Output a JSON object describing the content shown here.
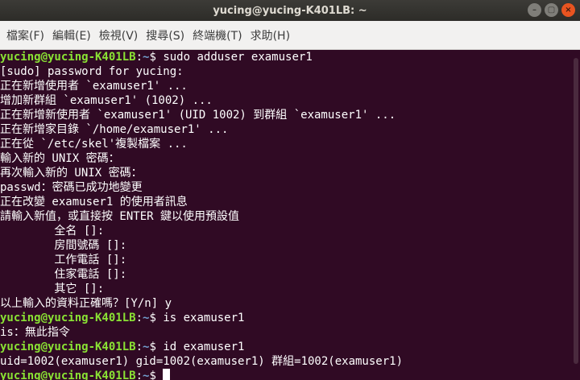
{
  "window": {
    "title": "yucing@yucing-K401LB: ~",
    "min_icon": "–",
    "max_icon": "▢",
    "close_icon": "×"
  },
  "menu": [
    {
      "label": "檔案(F)"
    },
    {
      "label": "編輯(E)"
    },
    {
      "label": "檢視(V)"
    },
    {
      "label": "搜尋(S)"
    },
    {
      "label": "終端機(T)"
    },
    {
      "label": "求助(H)"
    }
  ],
  "prompt": {
    "user_host": "yucing@yucing-K401LB",
    "sep": ":",
    "path": "~",
    "symbol": "$ "
  },
  "lines": [
    {
      "kind": "cmd",
      "text": "sudo adduser examuser1"
    },
    {
      "kind": "out",
      "text": "[sudo] password for yucing:"
    },
    {
      "kind": "out",
      "text": "正在新增使用者 `examuser1' ..."
    },
    {
      "kind": "out",
      "text": "增加新群組 `examuser1' (1002) ..."
    },
    {
      "kind": "out",
      "text": "正在新增新使用者 `examuser1' (UID 1002) 到群組 `examuser1' ..."
    },
    {
      "kind": "out",
      "text": "正在新增家目錄 `/home/examuser1' ..."
    },
    {
      "kind": "out",
      "text": "正在從 `/etc/skel'複製檔案 ..."
    },
    {
      "kind": "out",
      "text": "輸入新的 UNIX 密碼："
    },
    {
      "kind": "out",
      "text": "再次輸入新的 UNIX 密碼："
    },
    {
      "kind": "out",
      "text": "passwd：密碼已成功地變更"
    },
    {
      "kind": "out",
      "text": "正在改變 examuser1 的使用者訊息"
    },
    {
      "kind": "out",
      "text": "請輸入新值，或直接按 ENTER 鍵以使用預設值"
    },
    {
      "kind": "out",
      "text": "        全名 []:"
    },
    {
      "kind": "out",
      "text": "        房間號碼 []:"
    },
    {
      "kind": "out",
      "text": "        工作電話 []:"
    },
    {
      "kind": "out",
      "text": "        住家電話 []:"
    },
    {
      "kind": "out",
      "text": "        其它 []:"
    },
    {
      "kind": "out",
      "text": "以上輸入的資料正確嗎？[Y/n] y"
    },
    {
      "kind": "cmd",
      "text": "is examuser1"
    },
    {
      "kind": "out",
      "text": "is：無此指令"
    },
    {
      "kind": "cmd",
      "text": "id examuser1"
    },
    {
      "kind": "out",
      "text": "uid=1002(examuser1) gid=1002(examuser1) 群組=1002(examuser1)"
    },
    {
      "kind": "cmd",
      "text": ""
    }
  ]
}
